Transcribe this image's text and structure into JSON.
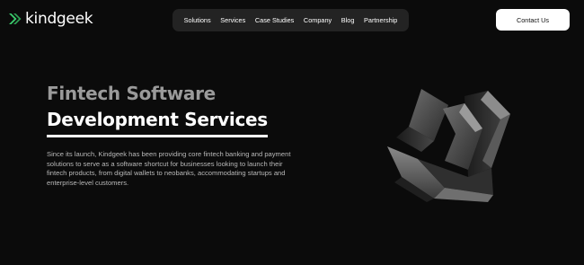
{
  "brand": {
    "name": "kindgeek",
    "logo_icon": "double-chevron-logo",
    "accent_color": "#3bd16f"
  },
  "nav": {
    "items": [
      {
        "label": "Solutions"
      },
      {
        "label": "Services"
      },
      {
        "label": "Case Studies"
      },
      {
        "label": "Company"
      },
      {
        "label": "Blog"
      },
      {
        "label": "Partnership"
      }
    ]
  },
  "header": {
    "contact_label": "Contact Us"
  },
  "hero": {
    "title_line1": "Fintech Software",
    "title_line2": "Development Services",
    "description": "Since its launch, Kindgeek has been providing core fintech banking and payment solutions to serve as a software shortcut for businesses looking to launch their fintech products, from digital wallets to neobanks, accommodating startups and enterprise-level customers.",
    "graphic_icon": "3d-chevron-shape"
  },
  "colors": {
    "background": "#0b0b0b",
    "nav_background": "#232323",
    "title_muted": "#9a9a9a",
    "text_muted": "#b8b8b8"
  }
}
